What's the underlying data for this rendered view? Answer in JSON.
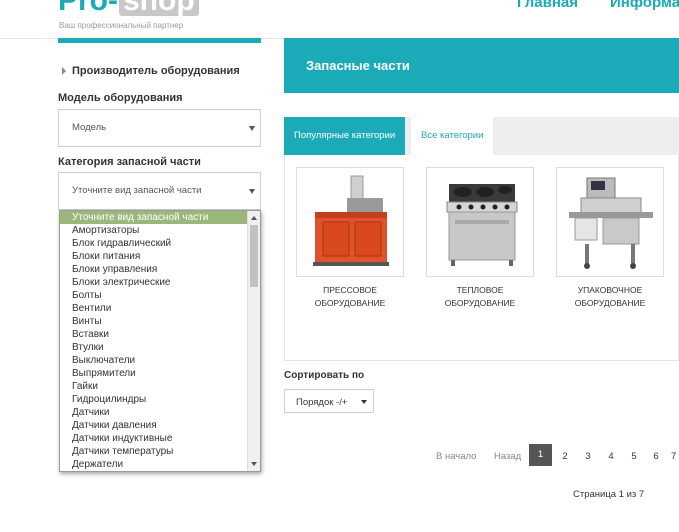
{
  "header": {
    "logo_pro": "Pro-",
    "logo_shop": "shop",
    "tagline": "Ваш профессиональный партнер",
    "nav": [
      "Главная",
      "Информа"
    ]
  },
  "sidebar": {
    "manufacturer_label": "Производитель оборудования",
    "model_label": "Модель оборудования",
    "model_value": "Модель",
    "category_label": "Категория запасной части",
    "category_value": "Уточните вид запасной части",
    "dropdown_options": [
      "Уточните вид запасной части",
      "Амортизаторы",
      "Блок гидравлический",
      "Блоки питания",
      "Блоки управления",
      "Блоки электрические",
      "Болты",
      "Вентили",
      "Винты",
      "Вставки",
      "Втулки",
      "Выключатели",
      "Выпрямители",
      "Гайки",
      "Гидроцилиндры",
      "Датчики",
      "Датчики давления",
      "Датчики индуктивные",
      "Датчики температуры",
      "Держатели"
    ]
  },
  "main": {
    "banner_title": "Запасные части",
    "tabs": [
      "Популярные категории",
      "Все категории"
    ],
    "cards": [
      {
        "line1": "ПРЕССОВОЕ",
        "line2": "ОБОРУДОВАНИЕ"
      },
      {
        "line1": "ТЕПЛОВОЕ",
        "line2": "ОБОРУДОВАНИЕ"
      },
      {
        "line1": "УПАКОВОЧНОЕ",
        "line2": "ОБОРУДОВАНИЕ"
      }
    ],
    "sort_label": "Сортировать по",
    "sort_value": "Порядок -/+"
  },
  "pagination": {
    "first": "В начало",
    "prev": "Назад",
    "pages": [
      "1",
      "2",
      "3",
      "4",
      "5",
      "6",
      "7"
    ],
    "active_page": "1",
    "info": "Страница 1 из 7"
  },
  "colors": {
    "accent": "#1aaab8",
    "selected_option": "#9bb77a",
    "active_page": "#555555"
  }
}
